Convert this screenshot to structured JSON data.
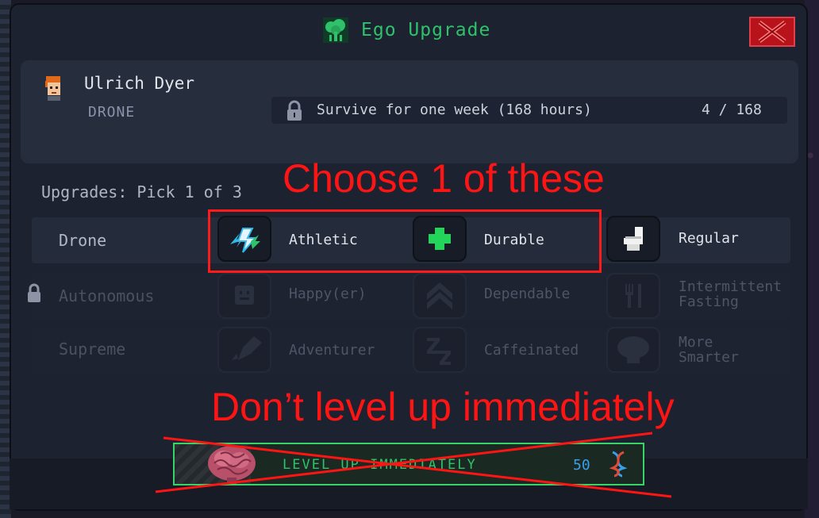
{
  "window": {
    "title": "Ego Upgrade"
  },
  "icons": {
    "title": "brain-tree-icon",
    "close": "close-x-icon",
    "lock": "padlock-icon"
  },
  "character": {
    "name": "Ulrich Dyer",
    "role": "DRONE"
  },
  "goal": {
    "text": "Survive for one week (168 hours)",
    "progress": "4 / 168"
  },
  "upgrades": {
    "header": "Upgrades: Pick 1 of 3",
    "rows": [
      {
        "tier": "Drone",
        "locked": false,
        "options": [
          {
            "label": "Athletic",
            "icon": "lightning-icon"
          },
          {
            "label": "Durable",
            "icon": "plus-icon"
          },
          {
            "label": "Regular",
            "icon": "toilet-icon"
          }
        ]
      },
      {
        "tier": "Autonomous",
        "locked": true,
        "options": [
          {
            "label": "Happy(er)",
            "icon": "smiley-icon"
          },
          {
            "label": "Dependable",
            "icon": "chevron-rank-icon"
          },
          {
            "label_line1": "Intermittent",
            "label_line2": "Fasting",
            "icon": "fork-knife-icon"
          }
        ]
      },
      {
        "tier": "Supreme",
        "locked": true,
        "options": [
          {
            "label": "Adventurer",
            "icon": "rocket-icon"
          },
          {
            "label": "Caffeinated",
            "icon": "zz-icon"
          },
          {
            "label_line1": "More",
            "label_line2": "Smarter",
            "icon": "brain-icon"
          }
        ]
      }
    ]
  },
  "level_button": {
    "label": "LEVEL UP IMMEDIATELY",
    "cost": "50",
    "icon": "dna-icon"
  },
  "annotations": {
    "choose": "Choose 1 of these",
    "dont_level": "Don’t level up immediately"
  },
  "colors": {
    "accent_green": "#2fc26a",
    "annotation_red": "#ff1414",
    "close_red": "#b8121a",
    "cost_blue": "#3a9ee8"
  }
}
